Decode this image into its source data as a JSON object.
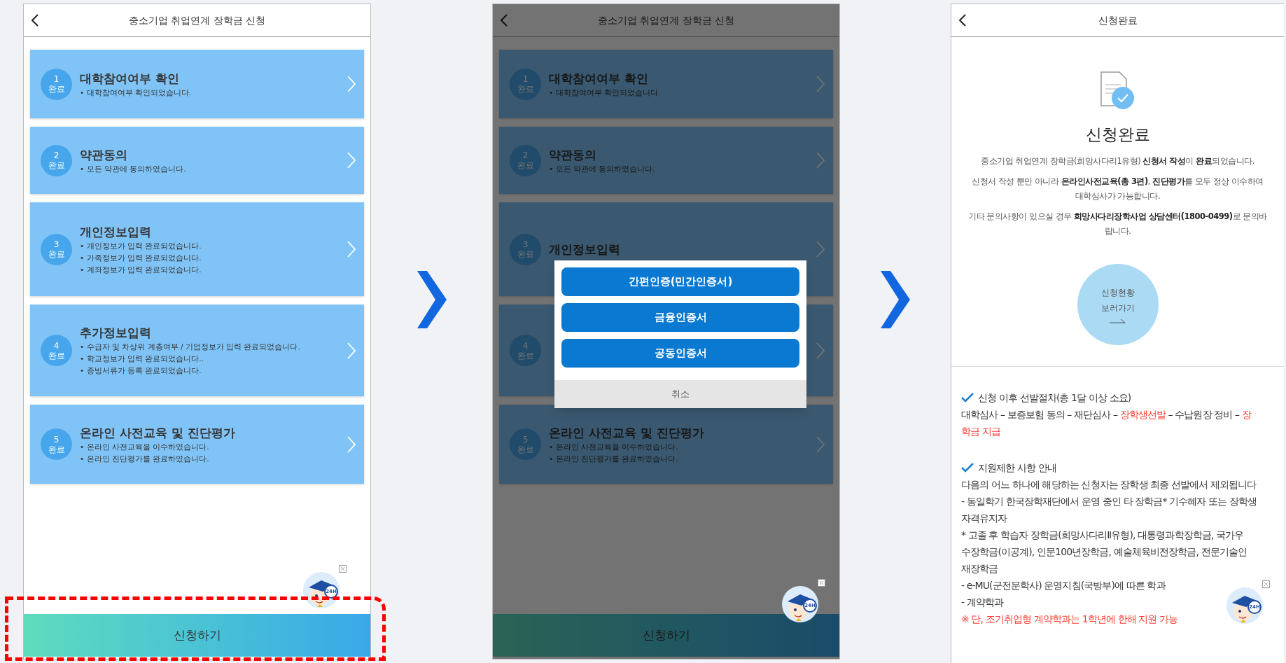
{
  "panels": [
    {
      "kind": "steps",
      "header": {
        "title": "중소기업 취업연계 장학금 신청"
      },
      "dimmed": false,
      "highlighted": true,
      "steps": [
        {
          "number": "1",
          "status": "완료",
          "title": "대학참여여부 확인",
          "lines": [
            "• 대학참여여부 확인되었습니다."
          ]
        },
        {
          "number": "2",
          "status": "완료",
          "title": "약관동의",
          "lines": [
            "• 모든 약관에 동의하였습니다."
          ]
        },
        {
          "number": "3",
          "status": "완료",
          "title": "개인정보입력",
          "lines": [
            "• 개인정보가 입력 완료되었습니다.",
            "• 가족정보가 입력 완료되었습니다.",
            "• 계좌정보가 입력 완료되었습니다."
          ]
        },
        {
          "number": "4",
          "status": "완료",
          "title": "추가정보입력",
          "lines": [
            "• 수급자 및 차상위 계층여부 / 기업정보가 입력 완료되었습니다.",
            "• 학교정보가 입력 완료되었습니다..",
            "• 증빙서류가 등록 완료되었습니다."
          ]
        },
        {
          "number": "5",
          "status": "완료",
          "title": "온라인 사전교육 및 진단평가",
          "lines": [
            "• 온라인 사전교육을 이수하였습니다.",
            "• 온라인 진단평가를 완료하였습니다."
          ]
        }
      ],
      "submit": "신청하기",
      "mascot_badge": "24H"
    },
    {
      "kind": "steps",
      "header": {
        "title": "중소기업 취업연계 장학금 신청"
      },
      "dimmed": true,
      "highlighted": false,
      "steps": [
        {
          "number": "1",
          "status": "완료",
          "title": "대학참여여부 확인",
          "lines": [
            "• 대학참여여부 확인되었습니다."
          ]
        },
        {
          "number": "2",
          "status": "완료",
          "title": "약관동의",
          "lines": [
            "• 모든 약관에 동의하였습니다."
          ]
        },
        {
          "number": "3",
          "status": "완료",
          "title": "개인정보입력"
        },
        {
          "number": "4",
          "status": "완료"
        },
        {
          "number": "5",
          "status": "완료",
          "title": "온라인 사전교육 및 진단평가",
          "lines": [
            "• 온라인 사전교육을 이수하였습니다.",
            "• 온라인 진단평가를 완료하였습니다."
          ]
        }
      ],
      "modal": {
        "options": [
          "간편인증(민간인증서)",
          "금융인증서",
          "공동인증서"
        ],
        "cancel": "취소"
      },
      "submit": "신청하기",
      "mascot_badge": "24H"
    },
    {
      "kind": "complete",
      "header": {
        "title": "신청완료"
      },
      "heading": "신청완료",
      "paragraphs": [
        [
          "중소기업 취업연계 장학금(희망사다리1유형) **신청서 작성**이 **완료**되었습니다."
        ],
        [
          "신청서 작성 뿐만 아니라 **온라인사전교육(총 3편)**, **진단평가**를 모두 정상 이수하여",
          "대학심사가 가능합니다."
        ],
        [
          "기타 문의사항이 있으실 경우 **희망사다리장학사업 상담센터(1800-0499)**로 문의바",
          "랍니다."
        ]
      ],
      "status_button": [
        "신청현황",
        "보러가기"
      ],
      "sections": [
        {
          "title": "신청 이후 선발절차(총 1달 이상 소요)",
          "lines": [
            [
              {
                "text": "대학심사 – 보증보험 동의 – 재단심사 – ",
                "highlight": false
              },
              {
                "text": "장학생선발",
                "highlight": true
              },
              {
                "text": " – 수납원장 정비 – ",
                "highlight": false
              },
              {
                "text": "장",
                "highlight": true
              }
            ],
            [
              {
                "text": "학금 지급",
                "highlight": true
              }
            ]
          ]
        },
        {
          "title": "지원제한 사항 안내",
          "lines": [
            [
              {
                "text": "다음의 어느 하나에 해당하는 신청자는 장학생 최종 선발에서 제외됩니다",
                "highlight": false
              }
            ],
            [
              {
                "text": "- 동일학기 한국장학재단에서 운영 중인 타 장학금* 기수혜자 또는 장학생",
                "highlight": false
              }
            ],
            [
              {
                "text": "자격유지자",
                "highlight": false
              }
            ],
            [
              {
                "text": "* 고졸 후 학습자 장학금(희망사다리Ⅱ유형), 대통령과학장학금, 국가우",
                "highlight": false
              }
            ],
            [
              {
                "text": "수장학금(이공계), 인문100년장학금, 예술체육비전장학금, 전문기술인",
                "highlight": false
              }
            ],
            [
              {
                "text": "재장학금",
                "highlight": false
              }
            ],
            [
              {
                "text": "- e-MU(군전문학사) 운영지침(국방부)에 따른 학과",
                "highlight": false
              }
            ],
            [
              {
                "text": "- 계약학과",
                "highlight": false
              }
            ],
            [
              {
                "text": "※ 단, 조기취업형 계약학과는 1학년에 한해 지원 가능",
                "highlight": true
              }
            ]
          ]
        }
      ],
      "mascot_badge": "24H"
    }
  ]
}
